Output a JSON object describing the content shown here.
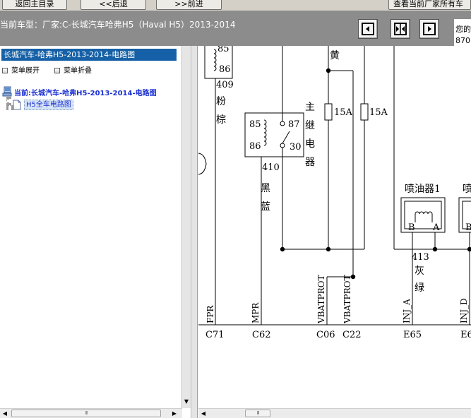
{
  "toolbar": {
    "back_to_home": "返回主目录",
    "back": "<<后退",
    "forward": ">>前进",
    "view_current": "查看当前厂家所有车"
  },
  "info_bar": {
    "vehicle_label": "当前车型：厂家:C-长城汽车哈弗H5（Haval H5）2013-2014",
    "notice_line1": "您的",
    "notice_line2": "870"
  },
  "tree": {
    "header": "长城汽车-哈弗H5-2013-2014-电路图",
    "expand_menu": "菜单展开",
    "collapse_menu": "菜单折叠",
    "root_label": "当前:长城汽车-哈弗H5-2013-2014-电路图",
    "child_label": "H5全车电路图"
  },
  "diagram": {
    "wire_409_number": "409",
    "wire_409_color_a": "粉",
    "wire_409_color_b": "棕",
    "relay_top_85": "85",
    "relay_top_86": "86",
    "yellow_color": "黄",
    "relay_pin_85": "85",
    "relay_pin_86": "86",
    "relay_pin_87": "87",
    "relay_pin_30": "30",
    "main_relay_a": "主",
    "main_relay_b": "继",
    "main_relay_c": "电",
    "main_relay_d": "器",
    "wire_410_number": "410",
    "wire_410_color_a": "黑",
    "wire_410_color_b": "蓝",
    "fuse1_rating": "15A",
    "fuse2_rating": "15A",
    "injector1_label": "喷油器1",
    "injector2_label": "喷",
    "injector1_pin_b": "B",
    "injector1_pin_a": "A",
    "injector2_pin_b": "B",
    "wire_413_number": "413",
    "wire_413_color_a": "灰",
    "wire_413_color_b": "绿",
    "sig_fpr": "FPR",
    "sig_mpr": "MPR",
    "sig_vbatprot_1": "VBATPROT",
    "sig_vbatprot_2": "VBATPROT",
    "sig_inj_a": "INJ_A",
    "sig_inj_d": "INJ_D",
    "pin_c71": "C71",
    "pin_c62": "C62",
    "pin_c06": "C06",
    "pin_c22": "C22",
    "pin_e65": "E65",
    "pin_e6": "E6"
  },
  "scrollbars": {
    "thumb_grip": "III",
    "arrow_left": "◀",
    "arrow_right": "▶",
    "arrow_down": "▼"
  }
}
